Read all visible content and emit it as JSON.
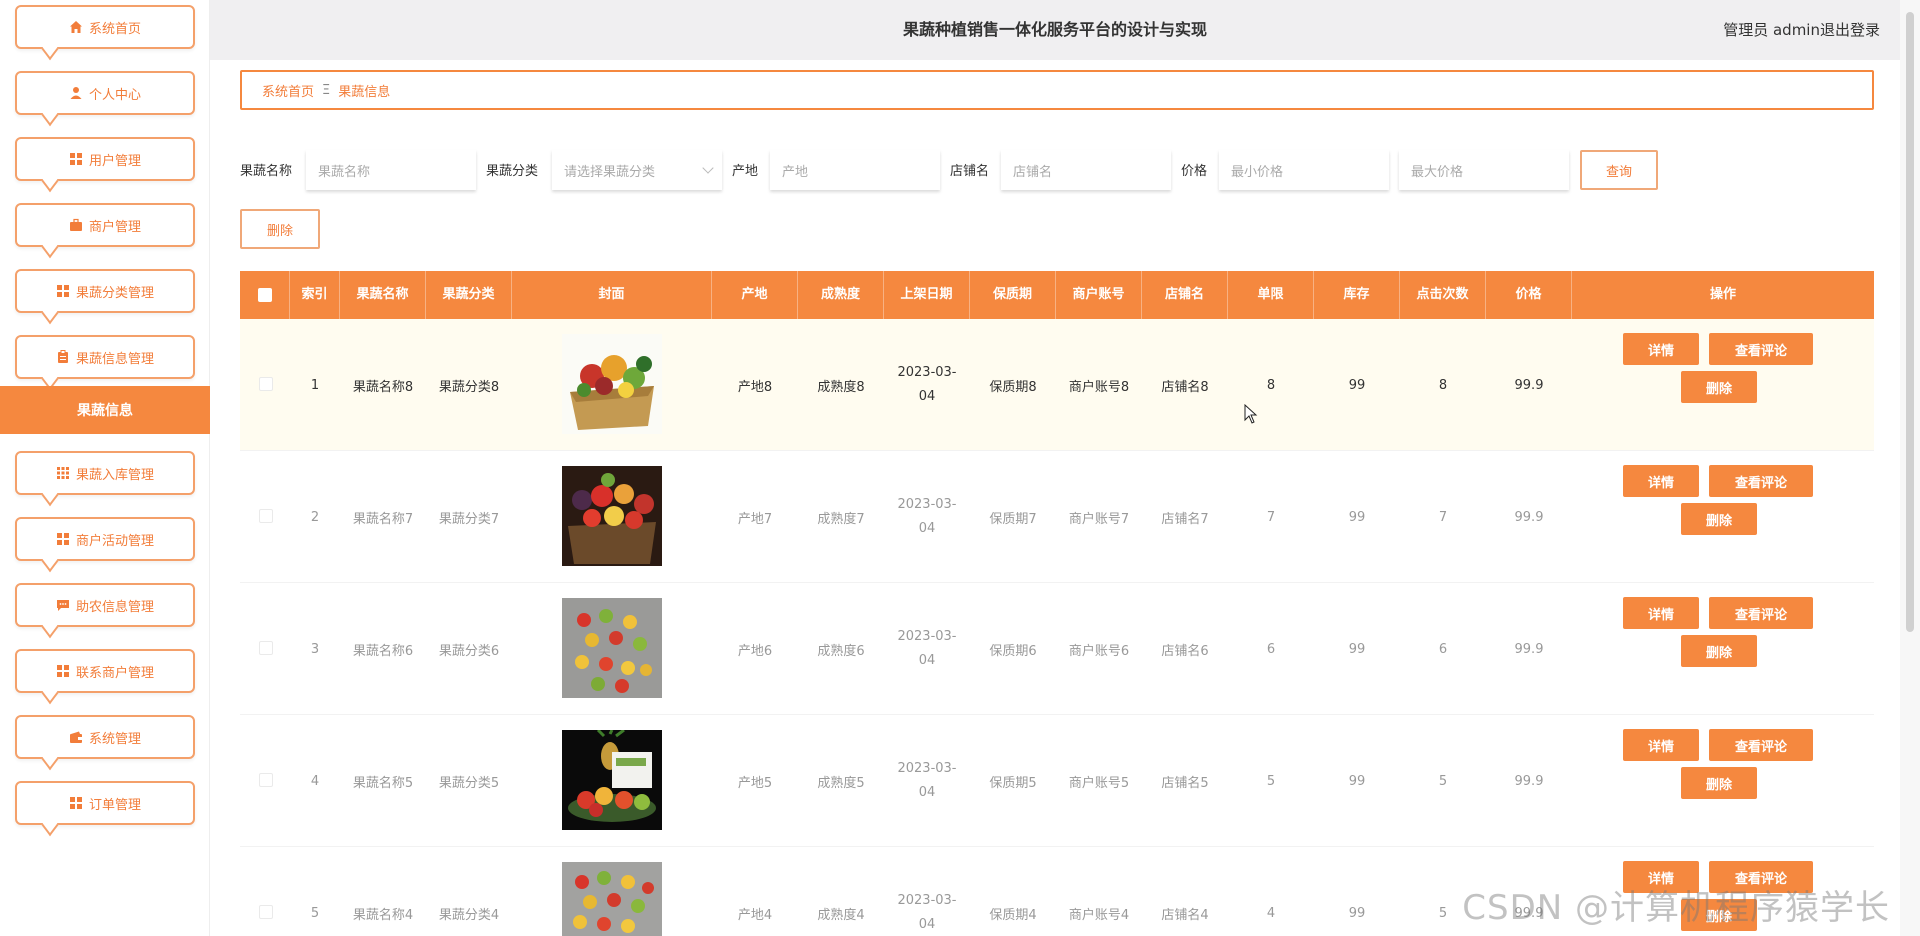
{
  "header": {
    "title": "果蔬种植销售一体化服务平台的设计与实现",
    "user": "管理员 admin",
    "logout": "退出登录"
  },
  "sidebar": {
    "items": [
      {
        "label": "系统首页",
        "icon": "home-icon"
      },
      {
        "label": "个人中心",
        "icon": "user-icon"
      },
      {
        "label": "用户管理",
        "icon": "grid-icon"
      },
      {
        "label": "商户管理",
        "icon": "briefcase-icon"
      },
      {
        "label": "果蔬分类管理",
        "icon": "grid-icon"
      },
      {
        "label": "果蔬信息管理",
        "icon": "clipboard-icon"
      },
      {
        "label": "果蔬入库管理",
        "icon": "grid-icon"
      },
      {
        "label": "商户活动管理",
        "icon": "grid-icon"
      },
      {
        "label": "助农信息管理",
        "icon": "chat-icon"
      },
      {
        "label": "联系商户管理",
        "icon": "grid-icon"
      },
      {
        "label": "系统管理",
        "icon": "wallet-icon"
      },
      {
        "label": "订单管理",
        "icon": "grid-icon"
      }
    ],
    "active_sub": "果蔬信息"
  },
  "breadcrumb": {
    "home": "系统首页",
    "separator": "Ξ",
    "current": "果蔬信息"
  },
  "search": {
    "name_label": "果蔬名称",
    "name_placeholder": "果蔬名称",
    "category_label": "果蔬分类",
    "category_placeholder": "请选择果蔬分类",
    "origin_label": "产地",
    "origin_placeholder": "产地",
    "shop_label": "店铺名",
    "shop_placeholder": "店铺名",
    "price_label": "价格",
    "min_price_placeholder": "最小价格",
    "max_price_placeholder": "最大价格",
    "query_button": "查询",
    "delete_button": "删除"
  },
  "table": {
    "headers": [
      "索引",
      "果蔬名称",
      "果蔬分类",
      "封面",
      "产地",
      "成熟度",
      "上架日期",
      "保质期",
      "商户账号",
      "店铺名",
      "单限",
      "库存",
      "点击次数",
      "价格",
      "操作"
    ],
    "actions": {
      "detail": "详情",
      "comments": "查看评论",
      "delete": "删除"
    },
    "rows": [
      {
        "index": "1",
        "name": "果蔬名称8",
        "category": "果蔬分类8",
        "origin": "产地8",
        "maturity": "成熟度8",
        "date": "2023-03-04",
        "shelf": "保质期8",
        "account": "商户账号8",
        "shop": "店铺名8",
        "limit": "8",
        "stock": "99",
        "clicks": "8",
        "price": "99.9"
      },
      {
        "index": "2",
        "name": "果蔬名称7",
        "category": "果蔬分类7",
        "origin": "产地7",
        "maturity": "成熟度7",
        "date": "2023-03-04",
        "shelf": "保质期7",
        "account": "商户账号7",
        "shop": "店铺名7",
        "limit": "7",
        "stock": "99",
        "clicks": "7",
        "price": "99.9"
      },
      {
        "index": "3",
        "name": "果蔬名称6",
        "category": "果蔬分类6",
        "origin": "产地6",
        "maturity": "成熟度6",
        "date": "2023-03-04",
        "shelf": "保质期6",
        "account": "商户账号6",
        "shop": "店铺名6",
        "limit": "6",
        "stock": "99",
        "clicks": "6",
        "price": "99.9"
      },
      {
        "index": "4",
        "name": "果蔬名称5",
        "category": "果蔬分类5",
        "origin": "产地5",
        "maturity": "成熟度5",
        "date": "2023-03-04",
        "shelf": "保质期5",
        "account": "商户账号5",
        "shop": "店铺名5",
        "limit": "5",
        "stock": "99",
        "clicks": "5",
        "price": "99.9"
      },
      {
        "index": "5",
        "name": "果蔬名称4",
        "category": "果蔬分类4",
        "origin": "产地4",
        "maturity": "成熟度4",
        "date": "2023-03-04",
        "shelf": "保质期4",
        "account": "商户账号4",
        "shop": "店铺名4",
        "limit": "4",
        "stock": "99",
        "clicks": "5",
        "price": "99.9"
      }
    ]
  },
  "watermark": "CSDN @计算机程序猿学长",
  "colors": {
    "accent": "#f5883f",
    "accent_text": "#f27d3a",
    "header_bg": "#f0eff1"
  }
}
